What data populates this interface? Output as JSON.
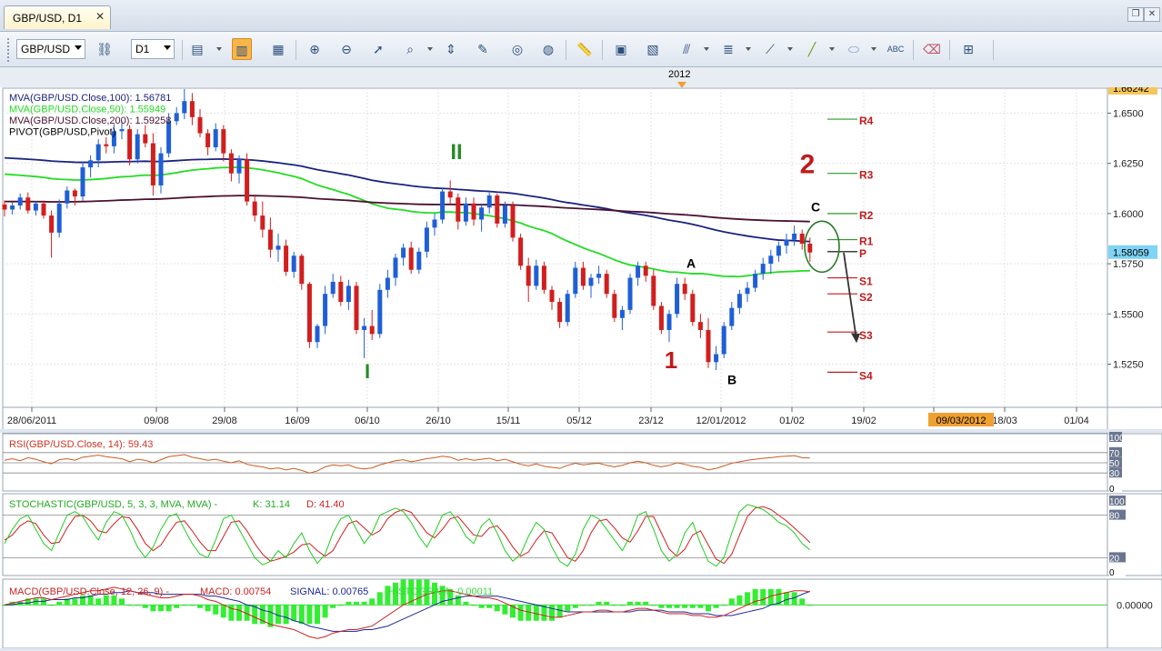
{
  "tab": {
    "title": "GBP/USD, D1",
    "close": "✕"
  },
  "window_buttons": [
    "restore",
    "close"
  ],
  "toolbar": {
    "symbol": "GBP/USD",
    "timeframe": "D1",
    "icons": [
      "disconnect-icon",
      "indicator-window-icon",
      "candles-icon",
      "bars-icon",
      "zoom-in-icon",
      "zoom-out-icon",
      "cursor-icon",
      "zoom-icon",
      "level-icon",
      "data-window-icon",
      "history-icon",
      "globe-icon",
      "ruler-icon",
      "chart-image-icon",
      "chart-template-icon",
      "fibonacci-icon",
      "channel-icon",
      "trendline-fan-icon",
      "line-icon",
      "ellipse-icon",
      "text-label-icon",
      "eraser-icon",
      "object-tree-icon"
    ]
  },
  "timebar": {
    "year_label": "2012"
  },
  "main_chart": {
    "legend": [
      {
        "text": "MVA(GBP/USD.Close,100): 1.56781",
        "color": "#1a237e"
      },
      {
        "text": "MVA(GBP/USD.Close,50): 1.55949",
        "color": "#22dd22"
      },
      {
        "text": "MVA(GBP/USD.Close,200): 1.59258",
        "color": "#4a1030"
      },
      {
        "text": "PIVOT(GBP/USD,Pivot)",
        "color": "#000000"
      }
    ],
    "price_ticks": [
      "1.6500",
      "1.6250",
      "1.6000",
      "1.5750",
      "1.5500",
      "1.5250"
    ],
    "top_price": "1.66242",
    "last_price": "1.58059",
    "date_ticks": [
      "28/06/2011",
      "09/08",
      "29/08",
      "16/09",
      "06/10",
      "26/10",
      "15/11",
      "05/12",
      "23/12",
      "12/01/2012",
      "01/02",
      "19/02",
      "04",
      "18/03",
      "01/04"
    ],
    "cursor_date": "09/03/2012",
    "pivot_labels": [
      "R4",
      "R3",
      "R2",
      "R1",
      "P",
      "S1",
      "S2",
      "S3",
      "S4"
    ],
    "annotations": {
      "wave_I": "I",
      "wave_II": "II",
      "wave_1": "1",
      "wave_2": "2",
      "point_A": "A",
      "point_B": "B",
      "point_C": "C"
    },
    "candles_ohlc": [
      [
        1.6045,
        1.6065,
        1.5985,
        1.602
      ],
      [
        1.602,
        1.6055,
        1.5995,
        1.604
      ],
      [
        1.604,
        1.61,
        1.602,
        1.608
      ],
      [
        1.608,
        1.6105,
        1.6,
        1.6015
      ],
      [
        1.6015,
        1.606,
        1.599,
        1.605
      ],
      [
        1.605,
        1.6065,
        1.5975,
        1.599
      ],
      [
        1.599,
        1.6015,
        1.578,
        1.5905
      ],
      [
        1.5905,
        1.607,
        1.588,
        1.605
      ],
      [
        1.605,
        1.6135,
        1.6025,
        1.6115
      ],
      [
        1.6115,
        1.6125,
        1.604,
        1.6085
      ],
      [
        1.6085,
        1.626,
        1.6065,
        1.623
      ],
      [
        1.623,
        1.629,
        1.618,
        1.6265
      ],
      [
        1.6265,
        1.637,
        1.623,
        1.6345
      ],
      [
        1.6345,
        1.638,
        1.63,
        1.6335
      ],
      [
        1.6335,
        1.6445,
        1.63,
        1.641
      ],
      [
        1.641,
        1.646,
        1.637,
        1.642
      ],
      [
        1.642,
        1.644,
        1.624,
        1.627
      ],
      [
        1.627,
        1.642,
        1.625,
        1.6395
      ],
      [
        1.6395,
        1.644,
        1.633,
        1.635
      ],
      [
        1.635,
        1.64,
        1.609,
        1.614
      ],
      [
        1.614,
        1.633,
        1.61,
        1.63
      ],
      [
        1.63,
        1.65,
        1.628,
        1.646
      ],
      [
        1.646,
        1.653,
        1.644,
        1.65
      ],
      [
        1.65,
        1.662,
        1.647,
        1.656
      ],
      [
        1.656,
        1.66,
        1.644,
        1.648
      ],
      [
        1.648,
        1.652,
        1.638,
        1.64
      ],
      [
        1.64,
        1.642,
        1.629,
        1.633
      ],
      [
        1.633,
        1.645,
        1.631,
        1.642
      ],
      [
        1.642,
        1.644,
        1.626,
        1.63
      ],
      [
        1.63,
        1.632,
        1.616,
        1.62
      ],
      [
        1.62,
        1.629,
        1.615,
        1.627
      ],
      [
        1.627,
        1.63,
        1.604,
        1.606
      ],
      [
        1.606,
        1.609,
        1.596,
        1.599
      ],
      [
        1.599,
        1.606,
        1.588,
        1.592
      ],
      [
        1.592,
        1.598,
        1.578,
        1.582
      ],
      [
        1.582,
        1.59,
        1.576,
        1.584
      ],
      [
        1.584,
        1.587,
        1.569,
        1.571
      ],
      [
        1.571,
        1.581,
        1.568,
        1.579
      ],
      [
        1.579,
        1.58,
        1.562,
        1.565
      ],
      [
        1.565,
        1.566,
        1.533,
        1.536
      ],
      [
        1.536,
        1.545,
        1.533,
        1.544
      ],
      [
        1.544,
        1.564,
        1.54,
        1.56
      ],
      [
        1.56,
        1.57,
        1.558,
        1.566
      ],
      [
        1.566,
        1.569,
        1.554,
        1.556
      ],
      [
        1.556,
        1.567,
        1.552,
        1.564
      ],
      [
        1.564,
        1.566,
        1.54,
        1.542
      ],
      [
        1.542,
        1.548,
        1.528,
        1.544
      ],
      [
        1.544,
        1.552,
        1.537,
        1.54
      ],
      [
        1.54,
        1.565,
        1.538,
        1.562
      ],
      [
        1.562,
        1.572,
        1.558,
        1.568
      ],
      [
        1.568,
        1.58,
        1.564,
        1.578
      ],
      [
        1.578,
        1.585,
        1.574,
        1.583
      ],
      [
        1.583,
        1.586,
        1.57,
        1.572
      ],
      [
        1.572,
        1.583,
        1.57,
        1.581
      ],
      [
        1.581,
        1.596,
        1.578,
        1.593
      ],
      [
        1.593,
        1.6,
        1.589,
        1.597
      ],
      [
        1.597,
        1.613,
        1.595,
        1.611
      ],
      [
        1.611,
        1.6165,
        1.605,
        1.608
      ],
      [
        1.608,
        1.61,
        1.592,
        1.596
      ],
      [
        1.596,
        1.608,
        1.594,
        1.605
      ],
      [
        1.605,
        1.608,
        1.594,
        1.597
      ],
      [
        1.597,
        1.605,
        1.591,
        1.603
      ],
      [
        1.603,
        1.611,
        1.6,
        1.609
      ],
      [
        1.609,
        1.61,
        1.593,
        1.595
      ],
      [
        1.595,
        1.606,
        1.593,
        1.604
      ],
      [
        1.604,
        1.606,
        1.586,
        1.588
      ],
      [
        1.588,
        1.59,
        1.572,
        1.574
      ],
      [
        1.574,
        1.578,
        1.556,
        1.564
      ],
      [
        1.564,
        1.577,
        1.562,
        1.574
      ],
      [
        1.574,
        1.576,
        1.56,
        1.562
      ],
      [
        1.562,
        1.564,
        1.552,
        1.556
      ],
      [
        1.556,
        1.558,
        1.543,
        1.546
      ],
      [
        1.546,
        1.562,
        1.544,
        1.56
      ],
      [
        1.56,
        1.576,
        1.558,
        1.573
      ],
      [
        1.573,
        1.576,
        1.562,
        1.564
      ],
      [
        1.564,
        1.57,
        1.558,
        1.568
      ],
      [
        1.568,
        1.574,
        1.565,
        1.57
      ],
      [
        1.57,
        1.572,
        1.558,
        1.56
      ],
      [
        1.56,
        1.562,
        1.546,
        1.548
      ],
      [
        1.548,
        1.554,
        1.542,
        1.552
      ],
      [
        1.552,
        1.57,
        1.55,
        1.568
      ],
      [
        1.568,
        1.576,
        1.564,
        1.574
      ],
      [
        1.574,
        1.576,
        1.566,
        1.569
      ],
      [
        1.569,
        1.572,
        1.552,
        1.554
      ],
      [
        1.554,
        1.556,
        1.54,
        1.542
      ],
      [
        1.542,
        1.552,
        1.536,
        1.55
      ],
      [
        1.55,
        1.568,
        1.548,
        1.565
      ],
      [
        1.565,
        1.568,
        1.557,
        1.56
      ],
      [
        1.56,
        1.562,
        1.544,
        1.546
      ],
      [
        1.546,
        1.55,
        1.538,
        1.542
      ],
      [
        1.542,
        1.548,
        1.523,
        1.526
      ],
      [
        1.526,
        1.534,
        1.522,
        1.53
      ],
      [
        1.53,
        1.546,
        1.528,
        1.544
      ],
      [
        1.544,
        1.556,
        1.542,
        1.553
      ],
      [
        1.553,
        1.562,
        1.55,
        1.56
      ],
      [
        1.56,
        1.566,
        1.556,
        1.563
      ],
      [
        1.563,
        1.572,
        1.561,
        1.57
      ],
      [
        1.57,
        1.578,
        1.567,
        1.575
      ],
      [
        1.575,
        1.582,
        1.57,
        1.579
      ],
      [
        1.579,
        1.586,
        1.576,
        1.584
      ],
      [
        1.584,
        1.59,
        1.58,
        1.587
      ],
      [
        1.587,
        1.594,
        1.584,
        1.59
      ],
      [
        1.59,
        1.592,
        1.582,
        1.585
      ],
      [
        1.585,
        1.588,
        1.576,
        1.5806
      ]
    ]
  },
  "rsi_panel": {
    "label": "RSI(GBP/USD.Close, 14): 59.43",
    "ticks": [
      "100",
      "70",
      "50",
      "30",
      "0"
    ],
    "values": [
      55,
      58,
      54,
      60,
      57,
      52,
      48,
      56,
      58,
      55,
      61,
      63,
      65,
      62,
      60,
      58,
      52,
      57,
      55,
      50,
      56,
      62,
      64,
      66,
      61,
      58,
      55,
      57,
      53,
      50,
      54,
      47,
      44,
      42,
      38,
      40,
      36,
      39,
      35,
      30,
      34,
      42,
      46,
      44,
      46,
      40,
      38,
      40,
      46,
      50,
      54,
      56,
      52,
      55,
      58,
      60,
      63,
      61,
      55,
      58,
      55,
      57,
      59,
      54,
      57,
      52,
      47,
      44,
      48,
      43,
      41,
      39,
      45,
      49,
      46,
      48,
      49,
      45,
      42,
      45,
      50,
      53,
      50,
      45,
      42,
      45,
      50,
      47,
      43,
      41,
      36,
      39,
      44,
      49,
      52,
      55,
      57,
      59,
      60,
      62,
      63,
      64,
      60,
      59.43
    ]
  },
  "stoch_panel": {
    "label": "STOCHASTIC(GBP/USD, 5, 3, 3, MVA, MVA) - ",
    "k_label": "K: 31.14",
    "d_label": "D: 41.40",
    "ticks": [
      "100",
      "80",
      "20",
      "0"
    ],
    "k": [
      40,
      60,
      75,
      80,
      60,
      40,
      30,
      55,
      80,
      85,
      78,
      60,
      45,
      70,
      85,
      80,
      60,
      35,
      20,
      35,
      60,
      78,
      82,
      60,
      40,
      25,
      20,
      45,
      75,
      80,
      60,
      40,
      20,
      10,
      15,
      30,
      20,
      40,
      55,
      30,
      12,
      25,
      55,
      75,
      80,
      60,
      40,
      55,
      80,
      85,
      90,
      85,
      70,
      50,
      35,
      55,
      80,
      85,
      70,
      50,
      40,
      65,
      75,
      55,
      30,
      15,
      25,
      50,
      70,
      60,
      35,
      15,
      8,
      25,
      60,
      80,
      75,
      60,
      45,
      30,
      50,
      80,
      85,
      60,
      30,
      15,
      25,
      55,
      70,
      40,
      15,
      8,
      20,
      55,
      85,
      95,
      92,
      88,
      80,
      70,
      65,
      55,
      40,
      31.14
    ],
    "d": [
      45,
      52,
      65,
      72,
      68,
      52,
      40,
      42,
      62,
      78,
      80,
      72,
      58,
      55,
      68,
      78,
      76,
      60,
      40,
      30,
      38,
      55,
      70,
      72,
      58,
      42,
      30,
      30,
      50,
      70,
      72,
      58,
      40,
      25,
      15,
      18,
      22,
      28,
      38,
      40,
      30,
      22,
      30,
      50,
      68,
      72,
      62,
      52,
      58,
      75,
      84,
      88,
      84,
      70,
      55,
      48,
      60,
      75,
      78,
      65,
      52,
      50,
      62,
      65,
      52,
      35,
      22,
      28,
      45,
      58,
      55,
      38,
      20,
      15,
      30,
      55,
      72,
      74,
      62,
      48,
      42,
      58,
      78,
      78,
      55,
      32,
      22,
      32,
      52,
      58,
      38,
      18,
      12,
      25,
      52,
      78,
      90,
      92,
      88,
      80,
      72,
      62,
      52,
      41.4
    ]
  },
  "macd_panel": {
    "label_prefix": "MACD(GBP/USD.Close, 12, 26, 9) - ",
    "macd_label": "MACD: 0.00754",
    "signal_label": "SIGNAL: 0.00765",
    "hist_label": "HISTOGRAM: -0.00011",
    "ticks": [
      "0.00000"
    ],
    "macd": [
      0.0,
      0.001,
      0.002,
      0.003,
      0.004,
      0.004,
      0.003,
      0.004,
      0.005,
      0.006,
      0.007,
      0.008,
      0.008,
      0.009,
      0.01,
      0.009,
      0.008,
      0.007,
      0.006,
      0.005,
      0.004,
      0.004,
      0.005,
      0.006,
      0.006,
      0.005,
      0.003,
      0.002,
      0.0,
      -0.002,
      -0.003,
      -0.005,
      -0.007,
      -0.009,
      -0.011,
      -0.012,
      -0.013,
      -0.014,
      -0.016,
      -0.018,
      -0.019,
      -0.018,
      -0.016,
      -0.015,
      -0.014,
      -0.014,
      -0.013,
      -0.012,
      -0.009,
      -0.006,
      -0.003,
      0.0,
      0.002,
      0.004,
      0.006,
      0.007,
      0.008,
      0.008,
      0.007,
      0.006,
      0.005,
      0.004,
      0.004,
      0.003,
      0.001,
      -0.001,
      -0.003,
      -0.004,
      -0.005,
      -0.006,
      -0.007,
      -0.007,
      -0.006,
      -0.005,
      -0.004,
      -0.004,
      -0.003,
      -0.003,
      -0.004,
      -0.004,
      -0.003,
      -0.002,
      -0.002,
      -0.003,
      -0.004,
      -0.005,
      -0.005,
      -0.005,
      -0.006,
      -0.006,
      -0.007,
      -0.007,
      -0.006,
      -0.004,
      -0.002,
      0.0,
      0.002,
      0.003,
      0.005,
      0.006,
      0.007,
      0.008,
      0.008,
      0.0075
    ],
    "signal": [
      0.0,
      0.0,
      0.001,
      0.001,
      0.002,
      0.002,
      0.003,
      0.003,
      0.003,
      0.004,
      0.004,
      0.005,
      0.006,
      0.006,
      0.007,
      0.007,
      0.008,
      0.007,
      0.007,
      0.007,
      0.006,
      0.006,
      0.006,
      0.006,
      0.006,
      0.006,
      0.005,
      0.005,
      0.004,
      0.003,
      0.002,
      0.0,
      -0.001,
      -0.003,
      -0.004,
      -0.006,
      -0.007,
      -0.009,
      -0.01,
      -0.012,
      -0.013,
      -0.014,
      -0.015,
      -0.015,
      -0.015,
      -0.015,
      -0.014,
      -0.014,
      -0.013,
      -0.012,
      -0.01,
      -0.008,
      -0.006,
      -0.004,
      -0.002,
      0.0,
      0.002,
      0.003,
      0.004,
      0.005,
      0.005,
      0.005,
      0.005,
      0.005,
      0.004,
      0.003,
      0.002,
      0.001,
      0.0,
      -0.001,
      -0.002,
      -0.003,
      -0.004,
      -0.004,
      -0.004,
      -0.004,
      -0.004,
      -0.004,
      -0.004,
      -0.004,
      -0.004,
      -0.003,
      -0.003,
      -0.003,
      -0.003,
      -0.004,
      -0.004,
      -0.004,
      -0.005,
      -0.005,
      -0.005,
      -0.006,
      -0.006,
      -0.006,
      -0.005,
      -0.004,
      -0.003,
      -0.002,
      0.0,
      0.001,
      0.003,
      0.004,
      0.006,
      0.0077
    ]
  }
}
